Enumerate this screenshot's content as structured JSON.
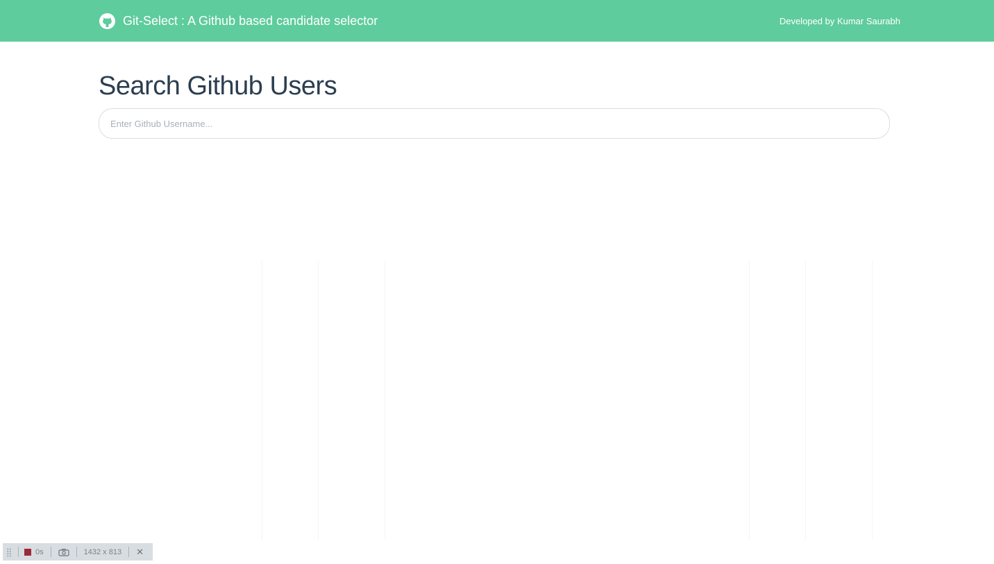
{
  "navbar": {
    "brand_icon": "github-octocat-icon",
    "brand_title": "Git-Select : A Github based candidate selector",
    "credit": "Developed by Kumar Saurabh",
    "color": "#5ecc9c"
  },
  "main": {
    "title": "Search Github Users",
    "search": {
      "placeholder": "Enter Github Username...",
      "value": ""
    }
  },
  "recorder": {
    "grip_icon": "drag-handle-icon",
    "stop_icon": "stop-record-icon",
    "timer": "0s",
    "camera_icon": "camera-icon",
    "dimensions": "1432 x 813",
    "close_icon": "close-icon"
  }
}
